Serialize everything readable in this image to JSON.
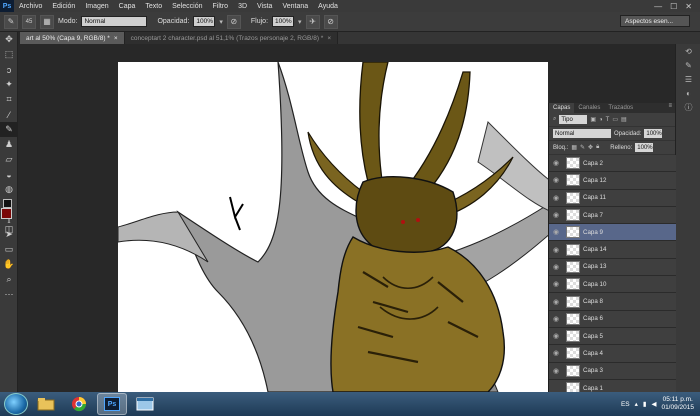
{
  "menubar": {
    "logo": "Ps",
    "items": [
      "Archivo",
      "Edición",
      "Imagen",
      "Capa",
      "Texto",
      "Selección",
      "Filtro",
      "3D",
      "Vista",
      "Ventana",
      "Ayuda"
    ],
    "window_controls": [
      "—",
      "☐",
      "✕"
    ]
  },
  "options": {
    "mode_label": "Modo:",
    "mode_value": "Normal",
    "opacity_label": "Opacidad:",
    "opacity_value": "100%",
    "flow_label": "Flujo:",
    "flow_value": "100%",
    "workspace": "Aspectos esen..."
  },
  "tabs": [
    {
      "label": "art al 50% (Capa 9, RGB/8) *",
      "close": "×"
    },
    {
      "label": "conceptart 2 character.psd al 51,1% (Trazos personaje 2, RGB/8) *",
      "close": "×"
    }
  ],
  "panel": {
    "tabs": [
      "Capas",
      "Canales",
      "Trazados"
    ],
    "filter_value": "Tipo",
    "blend_mode": "Normal",
    "opacity_label": "Opacidad:",
    "opacity_value": "100%",
    "lock_label": "Bloq.:",
    "fill_label": "Relleno:",
    "fill_value": "100%",
    "layers": [
      {
        "name": "Capa 2",
        "visible": true,
        "selected": false
      },
      {
        "name": "Capa 12",
        "visible": true,
        "selected": false
      },
      {
        "name": "Capa 11",
        "visible": true,
        "selected": false
      },
      {
        "name": "Capa 7",
        "visible": true,
        "selected": false
      },
      {
        "name": "Capa 9",
        "visible": true,
        "selected": true
      },
      {
        "name": "Capa 14",
        "visible": true,
        "selected": false
      },
      {
        "name": "Capa 13",
        "visible": true,
        "selected": false
      },
      {
        "name": "Capa 10",
        "visible": true,
        "selected": false
      },
      {
        "name": "Capa 8",
        "visible": true,
        "selected": false
      },
      {
        "name": "Capa 6",
        "visible": true,
        "selected": false
      },
      {
        "name": "Capa 5",
        "visible": true,
        "selected": false
      },
      {
        "name": "Capa 4",
        "visible": true,
        "selected": false
      },
      {
        "name": "Capa 3",
        "visible": true,
        "selected": false
      },
      {
        "name": "Capa 1",
        "visible": false,
        "selected": false
      }
    ]
  },
  "taskbar": {
    "apps": [
      "folder-icon",
      "chrome-icon",
      "photoshop-icon",
      "window-icon"
    ],
    "lang": "ES",
    "time": "05:11 p.m.",
    "date": "01/09/2015"
  }
}
